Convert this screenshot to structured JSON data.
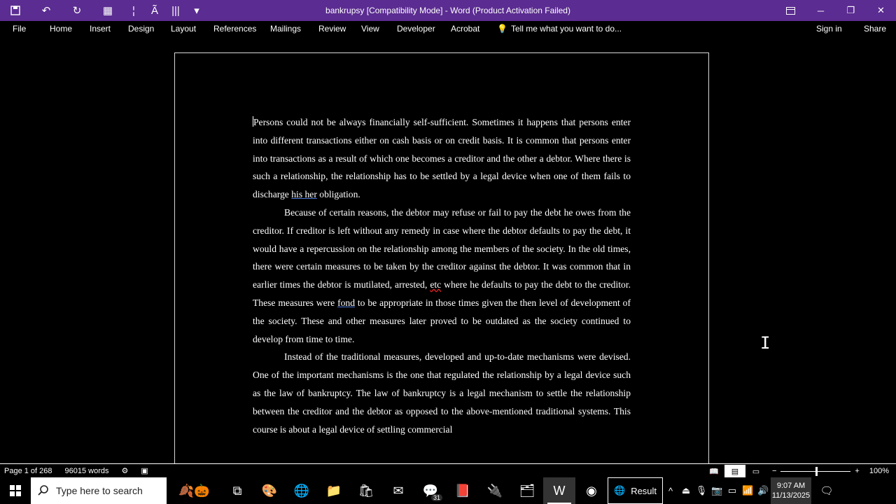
{
  "window": {
    "title": "bankrupsy [Compatibility Mode] - Word (Product Activation Failed)",
    "quick_access": [
      "save-icon",
      "undo-icon",
      "redo-icon",
      "format-painter-icon",
      "spelling-icon",
      "customize-icon"
    ],
    "controls": {
      "ribbon_display": "ribbon-display-icon",
      "minimize": "minimize-icon",
      "restore": "restore-icon",
      "close": "close-icon"
    }
  },
  "ribbon": {
    "tabs": [
      "File",
      "Home",
      "Insert",
      "Design",
      "Layout",
      "References",
      "Mailings",
      "Review",
      "View",
      "Developer",
      "Acrobat"
    ],
    "tell_me": "Tell me what you want to do...",
    "sign_in": "Sign in",
    "share": "Share"
  },
  "document": {
    "p1": {
      "before": "Persons could not be always financially self-sufficient. Sometimes it happens that persons enter into different transactions either on cash basis or on credit basis. It is common that persons enter into transactions as a result of which one becomes a creditor and the other a debtor. Where there is such a relationship, the relationship has to be settled by a legal device when one of them fails to discharge ",
      "flag": "his her",
      "after": " obligation."
    },
    "p2": {
      "a": "Because of certain reasons, the debtor may refuse or fail to pay the debt he owes from the creditor. If creditor is left without any remedy in case where the debtor defaults to pay the debt, it would have a repercussion on the relationship among the members of the society. In the old times, there were certain measures to be taken by the creditor against the debtor. It was common that in earlier times the debtor is mutilated, arrested, ",
      "flag_red": "etc",
      "b": " where he defaults to pay the debt to the creditor. These measures were ",
      "flag_blue": "fond",
      "c": " to be appropriate in those times given the then level of development of the society. These and other measures later proved to be outdated as the society continued to develop from time to time."
    },
    "p3": "Instead of the traditional measures, developed and up-to-date mechanisms were devised. One of the important mechanisms is the one that regulated the relationship by a legal device such as the law of bankruptcy. The law of bankruptcy is a legal mechanism to settle the relationship between the creditor and the debtor as opposed to the above-mentioned traditional systems. This course is about a legal device of settling commercial"
  },
  "status": {
    "page": "Page 1 of 268",
    "words": "96015 words",
    "zoom": "100%",
    "zoom_level_percent": 100
  },
  "taskbar": {
    "search_placeholder": "Type here to search",
    "apps": [
      "autumn-widget-icon",
      "task-view-icon",
      "paint-icon",
      "edge-icon",
      "file-explorer-icon",
      "store-icon",
      "outlook-icon",
      "messenger-icon",
      "acrobat-icon",
      "usb-icon",
      "folder-icon",
      "word-icon",
      "chrome-icon"
    ],
    "messenger_badge": "31",
    "result_label": "Result",
    "time": "9:07 AM",
    "date": "11/13/2025"
  }
}
